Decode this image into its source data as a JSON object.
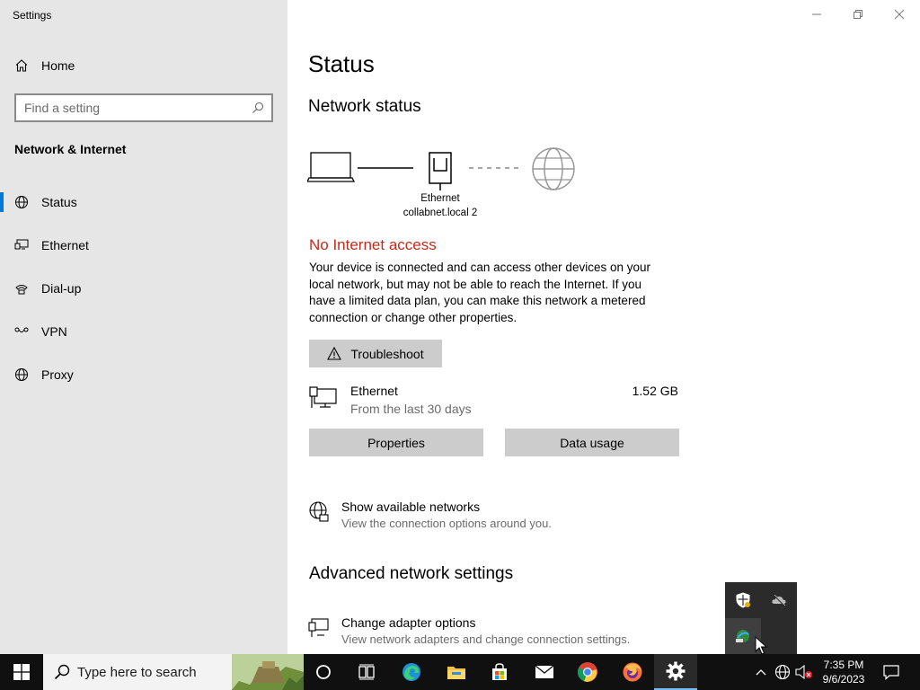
{
  "window": {
    "title": "Settings",
    "minimize_glyph": "—",
    "maximize_glyph": "❐",
    "close_glyph": "✕"
  },
  "sidebar": {
    "home_label": "Home",
    "search_placeholder": "Find a setting",
    "section_title": "Network & Internet",
    "items": [
      {
        "label": "Status",
        "icon": "status-icon",
        "selected": true
      },
      {
        "label": "Ethernet",
        "icon": "ethernet-icon",
        "selected": false
      },
      {
        "label": "Dial-up",
        "icon": "dial-up-icon",
        "selected": false
      },
      {
        "label": "VPN",
        "icon": "vpn-icon",
        "selected": false
      },
      {
        "label": "Proxy",
        "icon": "globe-icon",
        "selected": false
      }
    ]
  },
  "main": {
    "page_title": "Status",
    "network_status_heading": "Network status",
    "diagram": {
      "adapter_name": "Ethernet",
      "network_name": "collabnet.local 2"
    },
    "alert_title": "No Internet access",
    "alert_text": "Your device is connected and can access other devices on your local network, but may not be able to reach the Internet. If you have a limited data plan, you can make this network a metered connection or change other properties.",
    "troubleshoot_label": "Troubleshoot",
    "usage": {
      "name": "Ethernet",
      "period": "From the last 30 days",
      "amount": "1.52 GB"
    },
    "properties_label": "Properties",
    "data_usage_label": "Data usage",
    "show_networks": {
      "title": "Show available networks",
      "subtitle": "View the connection options around you."
    },
    "advanced_heading": "Advanced network settings",
    "adapter_options": {
      "title": "Change adapter options",
      "subtitle": "View network adapters and change connection settings."
    }
  },
  "taskbar": {
    "search_placeholder": "Type here to search",
    "pinned": [
      "cortana-icon",
      "task-view-icon",
      "edge-icon",
      "file-explorer-icon",
      "store-icon",
      "mail-icon",
      "chrome-icon",
      "firefox-icon",
      "settings-icon"
    ],
    "clock_time": "7:35 PM",
    "clock_date": "9/6/2023",
    "accent": "#76b9ed"
  },
  "colors": {
    "sidebar_bg": "#e6e6e6",
    "selected_bar": "#0078d7",
    "alert_red": "#c42b1c",
    "button_bg": "#cccccc",
    "taskbar_bg": "#101010"
  }
}
